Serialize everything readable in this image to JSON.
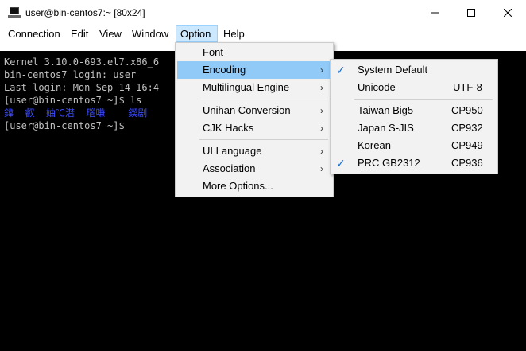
{
  "window": {
    "title": "user@bin-centos7:~ [80x24]"
  },
  "menubar": {
    "items": [
      "Connection",
      "Edit",
      "View",
      "Window",
      "Option",
      "Help"
    ]
  },
  "terminal": {
    "lines": [
      "Kernel 3.10.0-693.el7.x86_6",
      "bin-centos7 login: user",
      "Last login: Mon Sep 14 16:4",
      "[user@bin-centos7 ~]$ ls",
      "鍏  叡  妯℃澘  瑙嗛    鍥剧",
      "[user@bin-centos7 ~]$ "
    ]
  },
  "option_menu": {
    "items": [
      {
        "label": "Font",
        "submenu": false
      },
      {
        "label": "Encoding",
        "submenu": true
      },
      {
        "label": "Multilingual Engine",
        "submenu": true
      },
      {
        "label": "Unihan Conversion",
        "submenu": true
      },
      {
        "label": "CJK Hacks",
        "submenu": true
      },
      {
        "label": "UI Language",
        "submenu": true
      },
      {
        "label": "Association",
        "submenu": true
      },
      {
        "label": "More Options...",
        "submenu": false
      }
    ]
  },
  "encoding_menu": {
    "items": [
      {
        "label": "System Default",
        "value": "",
        "checked": true
      },
      {
        "label": "Unicode",
        "value": "UTF-8",
        "checked": false
      },
      {
        "label": "Taiwan Big5",
        "value": "CP950",
        "checked": false
      },
      {
        "label": "Japan S-JIS",
        "value": "CP932",
        "checked": false
      },
      {
        "label": "Korean",
        "value": "CP949",
        "checked": false
      },
      {
        "label": "PRC GB2312",
        "value": "CP936",
        "checked": true
      }
    ]
  },
  "glyphs": {
    "check": "✓",
    "arrow": "›"
  },
  "colors": {
    "highlight": "#91c9f7",
    "terminal_bg": "#000000",
    "terminal_fg": "#c0c0c0",
    "terminal_cjk": "#3b4bff",
    "check": "#1a6fd1"
  }
}
